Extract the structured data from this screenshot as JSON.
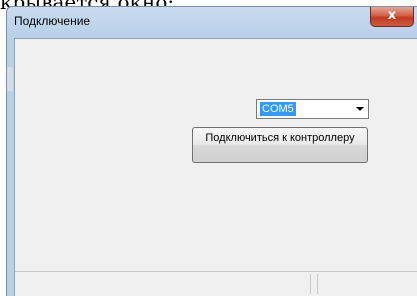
{
  "page": {
    "caption_fragment": "крывается окно:"
  },
  "window": {
    "title": "Подключение",
    "close_label": "x"
  },
  "port_select": {
    "selected": "COM5"
  },
  "connect_button": {
    "label": "Подключиться к контроллеру"
  },
  "icons": {
    "combo_arrow": "chevron-down-icon"
  }
}
